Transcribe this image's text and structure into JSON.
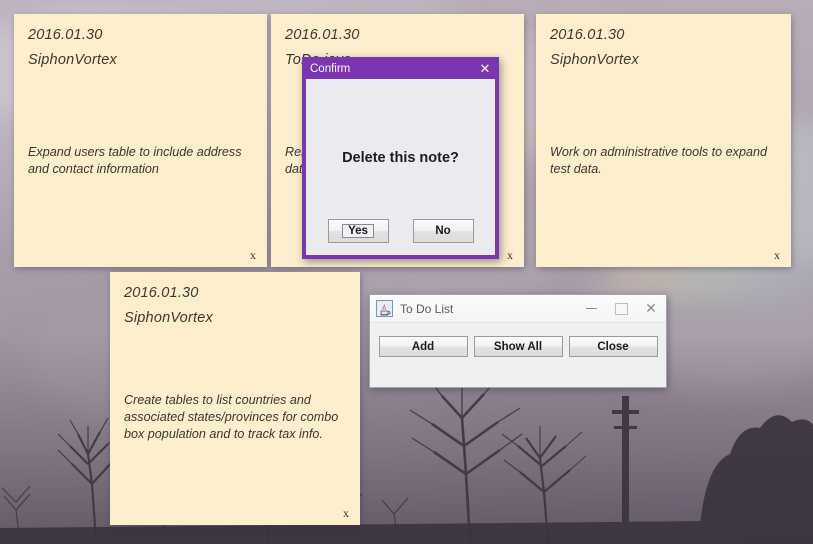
{
  "desktop": {
    "wallpaper_description": "dusk sky with mauve clouds, silhouetted bare trees and utility pole",
    "background_color": "#a89daa"
  },
  "notes": [
    {
      "id": "note-1",
      "date": "2016.01.30",
      "user": "SiphonVortex",
      "body": "Expand users table to include address and contact information",
      "close_label": "x"
    },
    {
      "id": "note-2",
      "date": "2016.01.30",
      "user": "ToDo.java",
      "body": "Rer\ndata",
      "close_label": "x"
    },
    {
      "id": "note-3",
      "date": "2016.01.30",
      "user": "SiphonVortex",
      "body": "Work on administrative tools to expand test data.",
      "close_label": "x"
    },
    {
      "id": "note-4",
      "date": "2016.01.30",
      "user": "SiphonVortex",
      "body": "Create tables to list countries and associated states/provinces for combo box population and to track tax info.",
      "close_label": "x"
    }
  ],
  "confirm_dialog": {
    "title": "Confirm",
    "close_glyph": "✕",
    "message": "Delete this note?",
    "yes_label": "Yes",
    "no_label": "No",
    "titlebar_color": "#7b34b2",
    "body_color": "#ebebef"
  },
  "todo_window": {
    "title": "To Do List",
    "icon": "java-cup-icon",
    "minimize_label": "—",
    "maximize_label": "□",
    "close_label": "✕",
    "buttons": [
      {
        "label": "Add"
      },
      {
        "label": "Show All"
      },
      {
        "label": "Close"
      }
    ]
  }
}
